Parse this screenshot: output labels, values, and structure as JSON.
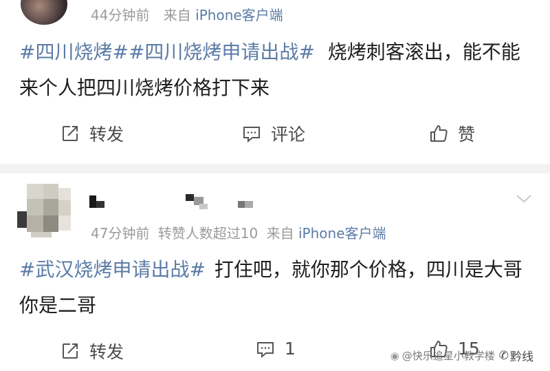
{
  "post1": {
    "meta": {
      "time": "44分钟前",
      "source_prefix": "来自",
      "source_device": "iPhone客户端"
    },
    "tag1": "#四川烧烤#",
    "tag2": "#四川烧烤申请出战#",
    "body": "烧烤刺客滚出，能不能来个人把四川烧烤价格打下来",
    "actions": {
      "repost": "转发",
      "comment": "评论",
      "like": "赞"
    }
  },
  "post2": {
    "meta": {
      "time": "47分钟前",
      "extra": "转赞人数超过10",
      "source_prefix": "来自",
      "source_device": "iPhone客户端"
    },
    "tag1": "#武汉烧烤申请出战#",
    "body": "打住吧，就你那个价格，四川是大哥你是二哥",
    "actions": {
      "repost": "转发",
      "comment_count": "1",
      "like_count": "15"
    }
  },
  "watermark": {
    "left": "@快乐追星小教学楼",
    "right": "黔线"
  }
}
